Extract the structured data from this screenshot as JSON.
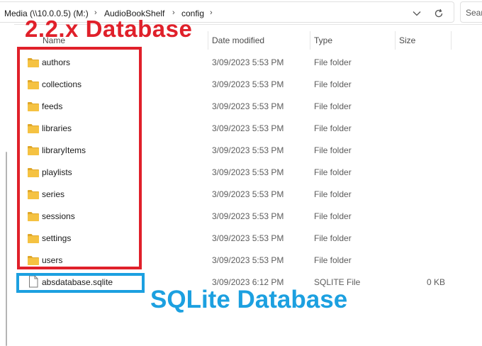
{
  "address": {
    "crumbs": [
      "Media (\\\\10.0.0.5) (M:)",
      "AudioBookShelf",
      "config"
    ],
    "search_placeholder": "Sear"
  },
  "columns": {
    "name": "Name",
    "date": "Date modified",
    "type": "Type",
    "size": "Size"
  },
  "files": [
    {
      "name": "authors",
      "date": "3/09/2023 5:53 PM",
      "type": "File folder",
      "size": "",
      "icon": "folder-icon"
    },
    {
      "name": "collections",
      "date": "3/09/2023 5:53 PM",
      "type": "File folder",
      "size": "",
      "icon": "folder-icon"
    },
    {
      "name": "feeds",
      "date": "3/09/2023 5:53 PM",
      "type": "File folder",
      "size": "",
      "icon": "folder-icon"
    },
    {
      "name": "libraries",
      "date": "3/09/2023 5:53 PM",
      "type": "File folder",
      "size": "",
      "icon": "folder-icon"
    },
    {
      "name": "libraryItems",
      "date": "3/09/2023 5:53 PM",
      "type": "File folder",
      "size": "",
      "icon": "folder-icon"
    },
    {
      "name": "playlists",
      "date": "3/09/2023 5:53 PM",
      "type": "File folder",
      "size": "",
      "icon": "folder-icon"
    },
    {
      "name": "series",
      "date": "3/09/2023 5:53 PM",
      "type": "File folder",
      "size": "",
      "icon": "folder-icon"
    },
    {
      "name": "sessions",
      "date": "3/09/2023 5:53 PM",
      "type": "File folder",
      "size": "",
      "icon": "folder-icon"
    },
    {
      "name": "settings",
      "date": "3/09/2023 5:53 PM",
      "type": "File folder",
      "size": "",
      "icon": "folder-icon"
    },
    {
      "name": "users",
      "date": "3/09/2023 5:53 PM",
      "type": "File folder",
      "size": "",
      "icon": "folder-icon"
    },
    {
      "name": "absdatabase.sqlite",
      "date": "3/09/2023 6:12 PM",
      "type": "SQLITE File",
      "size": "0 KB",
      "icon": "file-icon"
    }
  ],
  "annotations": {
    "red_label": "2.2.x Database",
    "blue_label": "SQLite Database",
    "red_color": "#e0202a",
    "blue_color": "#1ca0e0"
  },
  "colors": {
    "folder": "#f5c242",
    "folder_dark": "#e0a82a"
  }
}
